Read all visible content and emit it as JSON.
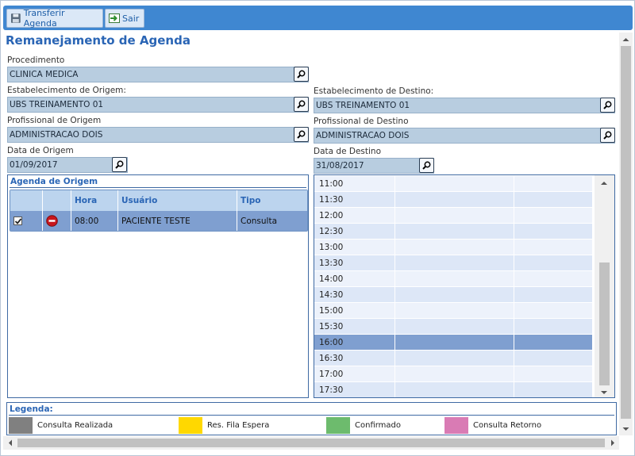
{
  "toolbar": {
    "transfer_label": "Transferir Agenda",
    "exit_label": "Sair"
  },
  "page_title": "Remanejamento de Agenda",
  "form": {
    "procedimento_label": "Procedimento",
    "procedimento_value": "CLINICA MEDICA",
    "estab_origem_label": "Estabelecimento de Origem:",
    "estab_origem_value": "UBS TREINAMENTO 01",
    "estab_destino_label": "Estabelecimento de Destino:",
    "estab_destino_value": "UBS TREINAMENTO 01",
    "prof_origem_label": "Profissional de Origem",
    "prof_origem_value": "ADMINISTRACAO DOIS",
    "prof_destino_label": "Profissional de Destino",
    "prof_destino_value": "ADMINISTRACAO DOIS",
    "data_origem_label": "Data de Origem",
    "data_origem_value": "01/09/2017",
    "data_destino_label": "Data de Destino",
    "data_destino_value": "31/08/2017"
  },
  "agenda_origem": {
    "title": "Agenda de Origem",
    "columns": [
      "Hora",
      "Usuário",
      "Tipo"
    ],
    "rows": [
      {
        "hora": "08:00",
        "usuario": "PACIENTE TESTE",
        "tipo": "Consulta",
        "checked": true
      }
    ]
  },
  "agenda_destino": {
    "slots": [
      "11:00",
      "11:30",
      "12:00",
      "12:30",
      "13:00",
      "13:30",
      "14:00",
      "14:30",
      "15:00",
      "15:30",
      "16:00",
      "16:30",
      "17:00",
      "17:30"
    ],
    "selected": "16:00"
  },
  "legend": {
    "title": "Legenda:",
    "items": [
      {
        "label": "Consulta Realizada",
        "color": "#808080"
      },
      {
        "label": "Res. Fila Espera",
        "color": "#ffd800"
      },
      {
        "label": "Confirmado",
        "color": "#6dbb6d"
      },
      {
        "label": "Consulta Retorno",
        "color": "#d97bb4"
      }
    ]
  }
}
